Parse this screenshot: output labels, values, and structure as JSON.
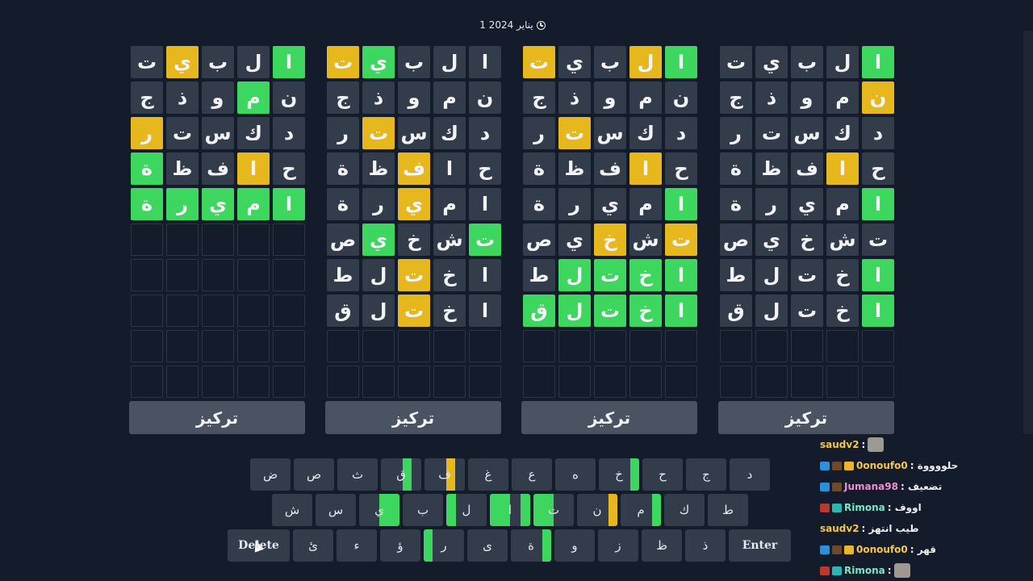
{
  "date": "1 يناير 2024",
  "focus_label": "تركيز",
  "colors": {
    "background": "#141c2c",
    "tile": "#323c4b",
    "green": "#3dd65e",
    "yellow": "#e6b81e",
    "focus_button": "#4a5362"
  },
  "icons": {
    "date": "clock-icon",
    "cursor": "mouse-cursor-icon"
  },
  "boards": [
    {
      "rows": [
        [
          [
            "ا",
            "g"
          ],
          [
            "ل",
            ""
          ],
          [
            "ب",
            ""
          ],
          [
            "ي",
            "y"
          ],
          [
            "ت",
            ""
          ]
        ],
        [
          [
            "ن",
            ""
          ],
          [
            "م",
            "g"
          ],
          [
            "و",
            ""
          ],
          [
            "ذ",
            ""
          ],
          [
            "ج",
            ""
          ]
        ],
        [
          [
            "د",
            ""
          ],
          [
            "ك",
            ""
          ],
          [
            "س",
            ""
          ],
          [
            "ت",
            ""
          ],
          [
            "ر",
            "y"
          ]
        ],
        [
          [
            "ح",
            ""
          ],
          [
            "ا",
            "y"
          ],
          [
            "ف",
            ""
          ],
          [
            "ظ",
            ""
          ],
          [
            "ة",
            "g"
          ]
        ],
        [
          [
            "ا",
            "g"
          ],
          [
            "م",
            "g"
          ],
          [
            "ي",
            "g"
          ],
          [
            "ر",
            "g"
          ],
          [
            "ة",
            "g"
          ]
        ]
      ],
      "empty_rows": 5
    },
    {
      "rows": [
        [
          [
            "ا",
            ""
          ],
          [
            "ل",
            ""
          ],
          [
            "ب",
            ""
          ],
          [
            "ي",
            "g"
          ],
          [
            "ت",
            "y"
          ]
        ],
        [
          [
            "ن",
            ""
          ],
          [
            "م",
            ""
          ],
          [
            "و",
            ""
          ],
          [
            "ذ",
            ""
          ],
          [
            "ج",
            ""
          ]
        ],
        [
          [
            "د",
            ""
          ],
          [
            "ك",
            ""
          ],
          [
            "س",
            ""
          ],
          [
            "ت",
            "y"
          ],
          [
            "ر",
            ""
          ]
        ],
        [
          [
            "ح",
            ""
          ],
          [
            "ا",
            ""
          ],
          [
            "ف",
            "y"
          ],
          [
            "ظ",
            ""
          ],
          [
            "ة",
            ""
          ]
        ],
        [
          [
            "ا",
            ""
          ],
          [
            "م",
            ""
          ],
          [
            "ي",
            "y"
          ],
          [
            "ر",
            ""
          ],
          [
            "ة",
            ""
          ]
        ],
        [
          [
            "ت",
            "g"
          ],
          [
            "ش",
            ""
          ],
          [
            "خ",
            ""
          ],
          [
            "ي",
            "g"
          ],
          [
            "ص",
            ""
          ]
        ],
        [
          [
            "ا",
            ""
          ],
          [
            "خ",
            ""
          ],
          [
            "ت",
            "y"
          ],
          [
            "ل",
            ""
          ],
          [
            "ط",
            ""
          ]
        ],
        [
          [
            "ا",
            ""
          ],
          [
            "خ",
            ""
          ],
          [
            "ت",
            "y"
          ],
          [
            "ل",
            ""
          ],
          [
            "ق",
            ""
          ]
        ]
      ],
      "empty_rows": 2
    },
    {
      "rows": [
        [
          [
            "ا",
            "g"
          ],
          [
            "ل",
            "y"
          ],
          [
            "ب",
            ""
          ],
          [
            "ي",
            ""
          ],
          [
            "ت",
            "y"
          ]
        ],
        [
          [
            "ن",
            ""
          ],
          [
            "م",
            ""
          ],
          [
            "و",
            ""
          ],
          [
            "ذ",
            ""
          ],
          [
            "ج",
            ""
          ]
        ],
        [
          [
            "د",
            ""
          ],
          [
            "ك",
            ""
          ],
          [
            "س",
            ""
          ],
          [
            "ت",
            "y"
          ],
          [
            "ر",
            ""
          ]
        ],
        [
          [
            "ح",
            ""
          ],
          [
            "ا",
            "y"
          ],
          [
            "ف",
            ""
          ],
          [
            "ظ",
            ""
          ],
          [
            "ة",
            ""
          ]
        ],
        [
          [
            "ا",
            "g"
          ],
          [
            "م",
            ""
          ],
          [
            "ي",
            ""
          ],
          [
            "ر",
            ""
          ],
          [
            "ة",
            ""
          ]
        ],
        [
          [
            "ت",
            "y"
          ],
          [
            "ش",
            ""
          ],
          [
            "خ",
            "y"
          ],
          [
            "ي",
            ""
          ],
          [
            "ص",
            ""
          ]
        ],
        [
          [
            "ا",
            "g"
          ],
          [
            "خ",
            "g"
          ],
          [
            "ت",
            "g"
          ],
          [
            "ل",
            "g"
          ],
          [
            "ط",
            ""
          ]
        ],
        [
          [
            "ا",
            "g"
          ],
          [
            "خ",
            "g"
          ],
          [
            "ت",
            "g"
          ],
          [
            "ل",
            "g"
          ],
          [
            "ق",
            "g"
          ]
        ]
      ],
      "empty_rows": 2
    },
    {
      "rows": [
        [
          [
            "ا",
            "g"
          ],
          [
            "ل",
            ""
          ],
          [
            "ب",
            ""
          ],
          [
            "ي",
            ""
          ],
          [
            "ت",
            ""
          ]
        ],
        [
          [
            "ن",
            "y"
          ],
          [
            "م",
            ""
          ],
          [
            "و",
            ""
          ],
          [
            "ذ",
            ""
          ],
          [
            "ج",
            ""
          ]
        ],
        [
          [
            "د",
            ""
          ],
          [
            "ك",
            ""
          ],
          [
            "س",
            ""
          ],
          [
            "ت",
            ""
          ],
          [
            "ر",
            ""
          ]
        ],
        [
          [
            "ح",
            ""
          ],
          [
            "ا",
            "y"
          ],
          [
            "ف",
            ""
          ],
          [
            "ظ",
            ""
          ],
          [
            "ة",
            ""
          ]
        ],
        [
          [
            "ا",
            "g"
          ],
          [
            "م",
            ""
          ],
          [
            "ي",
            ""
          ],
          [
            "ر",
            ""
          ],
          [
            "ة",
            ""
          ]
        ],
        [
          [
            "ت",
            ""
          ],
          [
            "ش",
            ""
          ],
          [
            "خ",
            ""
          ],
          [
            "ي",
            ""
          ],
          [
            "ص",
            ""
          ]
        ],
        [
          [
            "ا",
            "g"
          ],
          [
            "خ",
            ""
          ],
          [
            "ت",
            ""
          ],
          [
            "ل",
            ""
          ],
          [
            "ط",
            ""
          ]
        ],
        [
          [
            "ا",
            "g"
          ],
          [
            "خ",
            ""
          ],
          [
            "ت",
            ""
          ],
          [
            "ل",
            ""
          ],
          [
            "ق",
            ""
          ]
        ]
      ],
      "empty_rows": 2
    }
  ],
  "keyboard": {
    "row1": [
      {
        "k": "د"
      },
      {
        "k": "ج"
      },
      {
        "k": "ح"
      },
      {
        "k": "خ",
        "seg": [
          [
            "#3dd65e",
            0.78,
            0.22
          ]
        ]
      },
      {
        "k": "ه"
      },
      {
        "k": "ع"
      },
      {
        "k": "غ"
      },
      {
        "k": "ف",
        "seg": [
          [
            "#e6b81e",
            0.54,
            0.22
          ]
        ]
      },
      {
        "k": "ق",
        "seg": [
          [
            "#3dd65e",
            0.54,
            0.22
          ]
        ]
      },
      {
        "k": "ث"
      },
      {
        "k": "ص"
      },
      {
        "k": "ض"
      }
    ],
    "row2": [
      {
        "k": "ط"
      },
      {
        "k": "ك"
      },
      {
        "k": "م",
        "seg": [
          [
            "#3dd65e",
            0.78,
            0.22
          ]
        ]
      },
      {
        "k": "ن",
        "seg": [
          [
            "#e6b81e",
            0.78,
            0.22
          ]
        ]
      },
      {
        "k": "ت",
        "seg": [
          [
            "#3dd65e",
            0.0,
            0.5
          ]
        ]
      },
      {
        "k": "ا",
        "seg": [
          [
            "#3dd65e",
            0.0,
            0.5
          ],
          [
            "#3dd65e",
            0.76,
            0.24
          ]
        ]
      },
      {
        "k": "ل",
        "seg": [
          [
            "#3dd65e",
            0.0,
            0.24
          ]
        ]
      },
      {
        "k": "ب"
      },
      {
        "k": "ي",
        "seg": [
          [
            "#3dd65e",
            0.5,
            0.5
          ]
        ]
      },
      {
        "k": "س"
      },
      {
        "k": "ش"
      }
    ],
    "row3": [
      {
        "k": "Enter",
        "wide": true
      },
      {
        "k": "ذ"
      },
      {
        "k": "ظ"
      },
      {
        "k": "ز"
      },
      {
        "k": "و"
      },
      {
        "k": "ة",
        "seg": [
          [
            "#3dd65e",
            0.78,
            0.22
          ]
        ]
      },
      {
        "k": "ى"
      },
      {
        "k": "ر",
        "seg": [
          [
            "#3dd65e",
            0.0,
            0.22
          ]
        ]
      },
      {
        "k": "ؤ"
      },
      {
        "k": "ء"
      },
      {
        "k": "ئ"
      },
      {
        "k": "Delete",
        "wide": true
      }
    ]
  },
  "chat": [
    {
      "user": "saudv2",
      "color": "#f4c64a",
      "sep": " : ",
      "msg": "",
      "badges": [],
      "emote": true
    },
    {
      "user": "0onoufo0",
      "color": "#f4c64a",
      "sep": " : ",
      "msg": "حلووووة",
      "badges": [
        "b1",
        "b2",
        "b3"
      ],
      "emote": false
    },
    {
      "user": "Jumana98",
      "color": "#f08fd0",
      "sep": " : ",
      "msg": "تضعيف",
      "badges": [
        "b1",
        "b2"
      ],
      "emote": false
    },
    {
      "user": "Rimona",
      "color": "#7be6c8",
      "sep": " : ",
      "msg": "اووف",
      "badges": [
        "b5",
        "b4"
      ],
      "emote": false
    },
    {
      "user": "saudv2",
      "color": "#f4c64a",
      "sep": " : ",
      "msg": "طيب انتهز",
      "badges": [],
      "emote": false
    },
    {
      "user": "0onoufo0",
      "color": "#f4c64a",
      "sep": " : ",
      "msg": "قهر",
      "badges": [
        "b1",
        "b2",
        "b3"
      ],
      "emote": false
    },
    {
      "user": "Rimona",
      "color": "#7be6c8",
      "sep": " : ",
      "msg": "",
      "badges": [
        "b5",
        "b4"
      ],
      "emote": true
    }
  ]
}
